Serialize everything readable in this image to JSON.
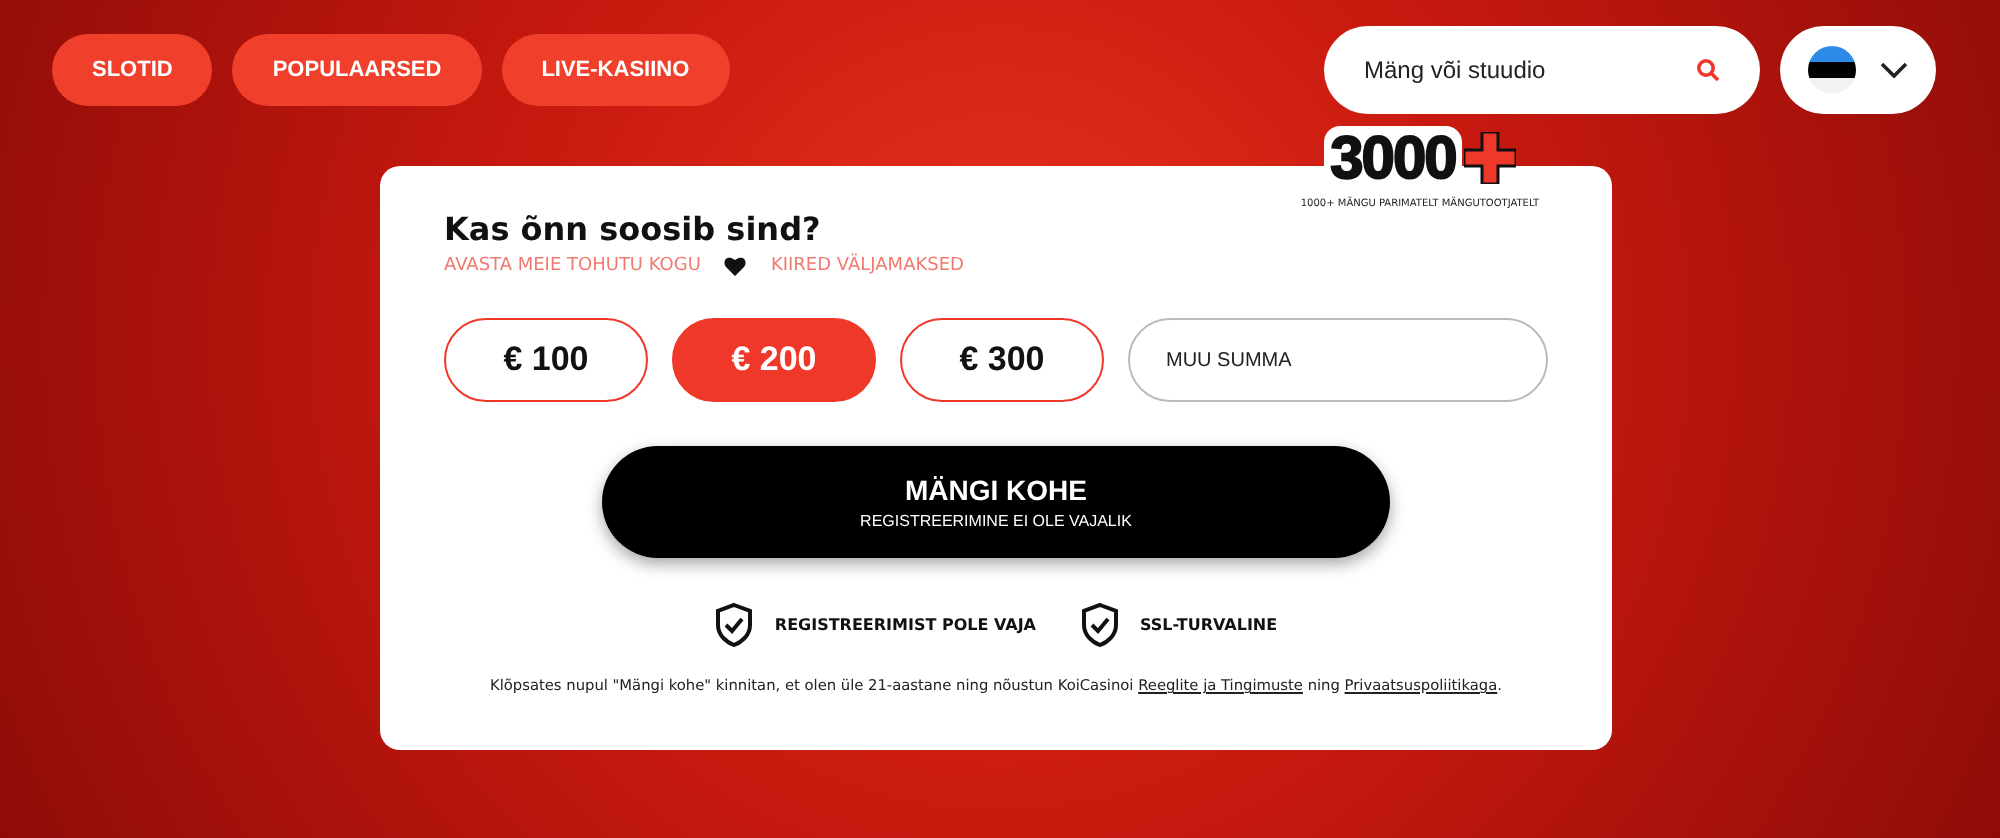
{
  "nav": {
    "items": [
      {
        "label": "SLOTID"
      },
      {
        "label": "POPULAARSED"
      },
      {
        "label": "LIVE-KASIINO"
      }
    ]
  },
  "search": {
    "placeholder": "Mäng või stuudio"
  },
  "logo": {
    "number": "3000",
    "caption": "1000+ MÄNGU PARIMATELT MÄNGUTOOTJATELT"
  },
  "card": {
    "title": "Kas õnn soosib sind?",
    "taglines": [
      "AVASTA MEIE TOHUTU KOGU",
      "KIIRED VÄLJAMAKSED"
    ],
    "amounts": [
      {
        "label": "€ 100",
        "selected": false
      },
      {
        "label": "€ 200",
        "selected": true
      },
      {
        "label": "€ 300",
        "selected": false
      }
    ],
    "custom_amount": {
      "placeholder": "MUU SUMMA"
    },
    "cta": {
      "title": "MÄNGI KOHE",
      "subtitle": "REGISTREERIMINE EI OLE VAJALIK"
    },
    "badges": [
      "REGISTREERIMIST POLE VAJA",
      "SSL-TURVALINE"
    ],
    "legal": {
      "before": "Klõpsates nupul \"Mängi kohe\" kinnitan, et olen üle 21-aastane ning nõustun KoiCasinoi ",
      "link_terms": "Reeglite ja Tingimuste",
      "middle": " ning ",
      "link_privacy": "Privaatsuspoliitikaga",
      "after": "."
    }
  }
}
